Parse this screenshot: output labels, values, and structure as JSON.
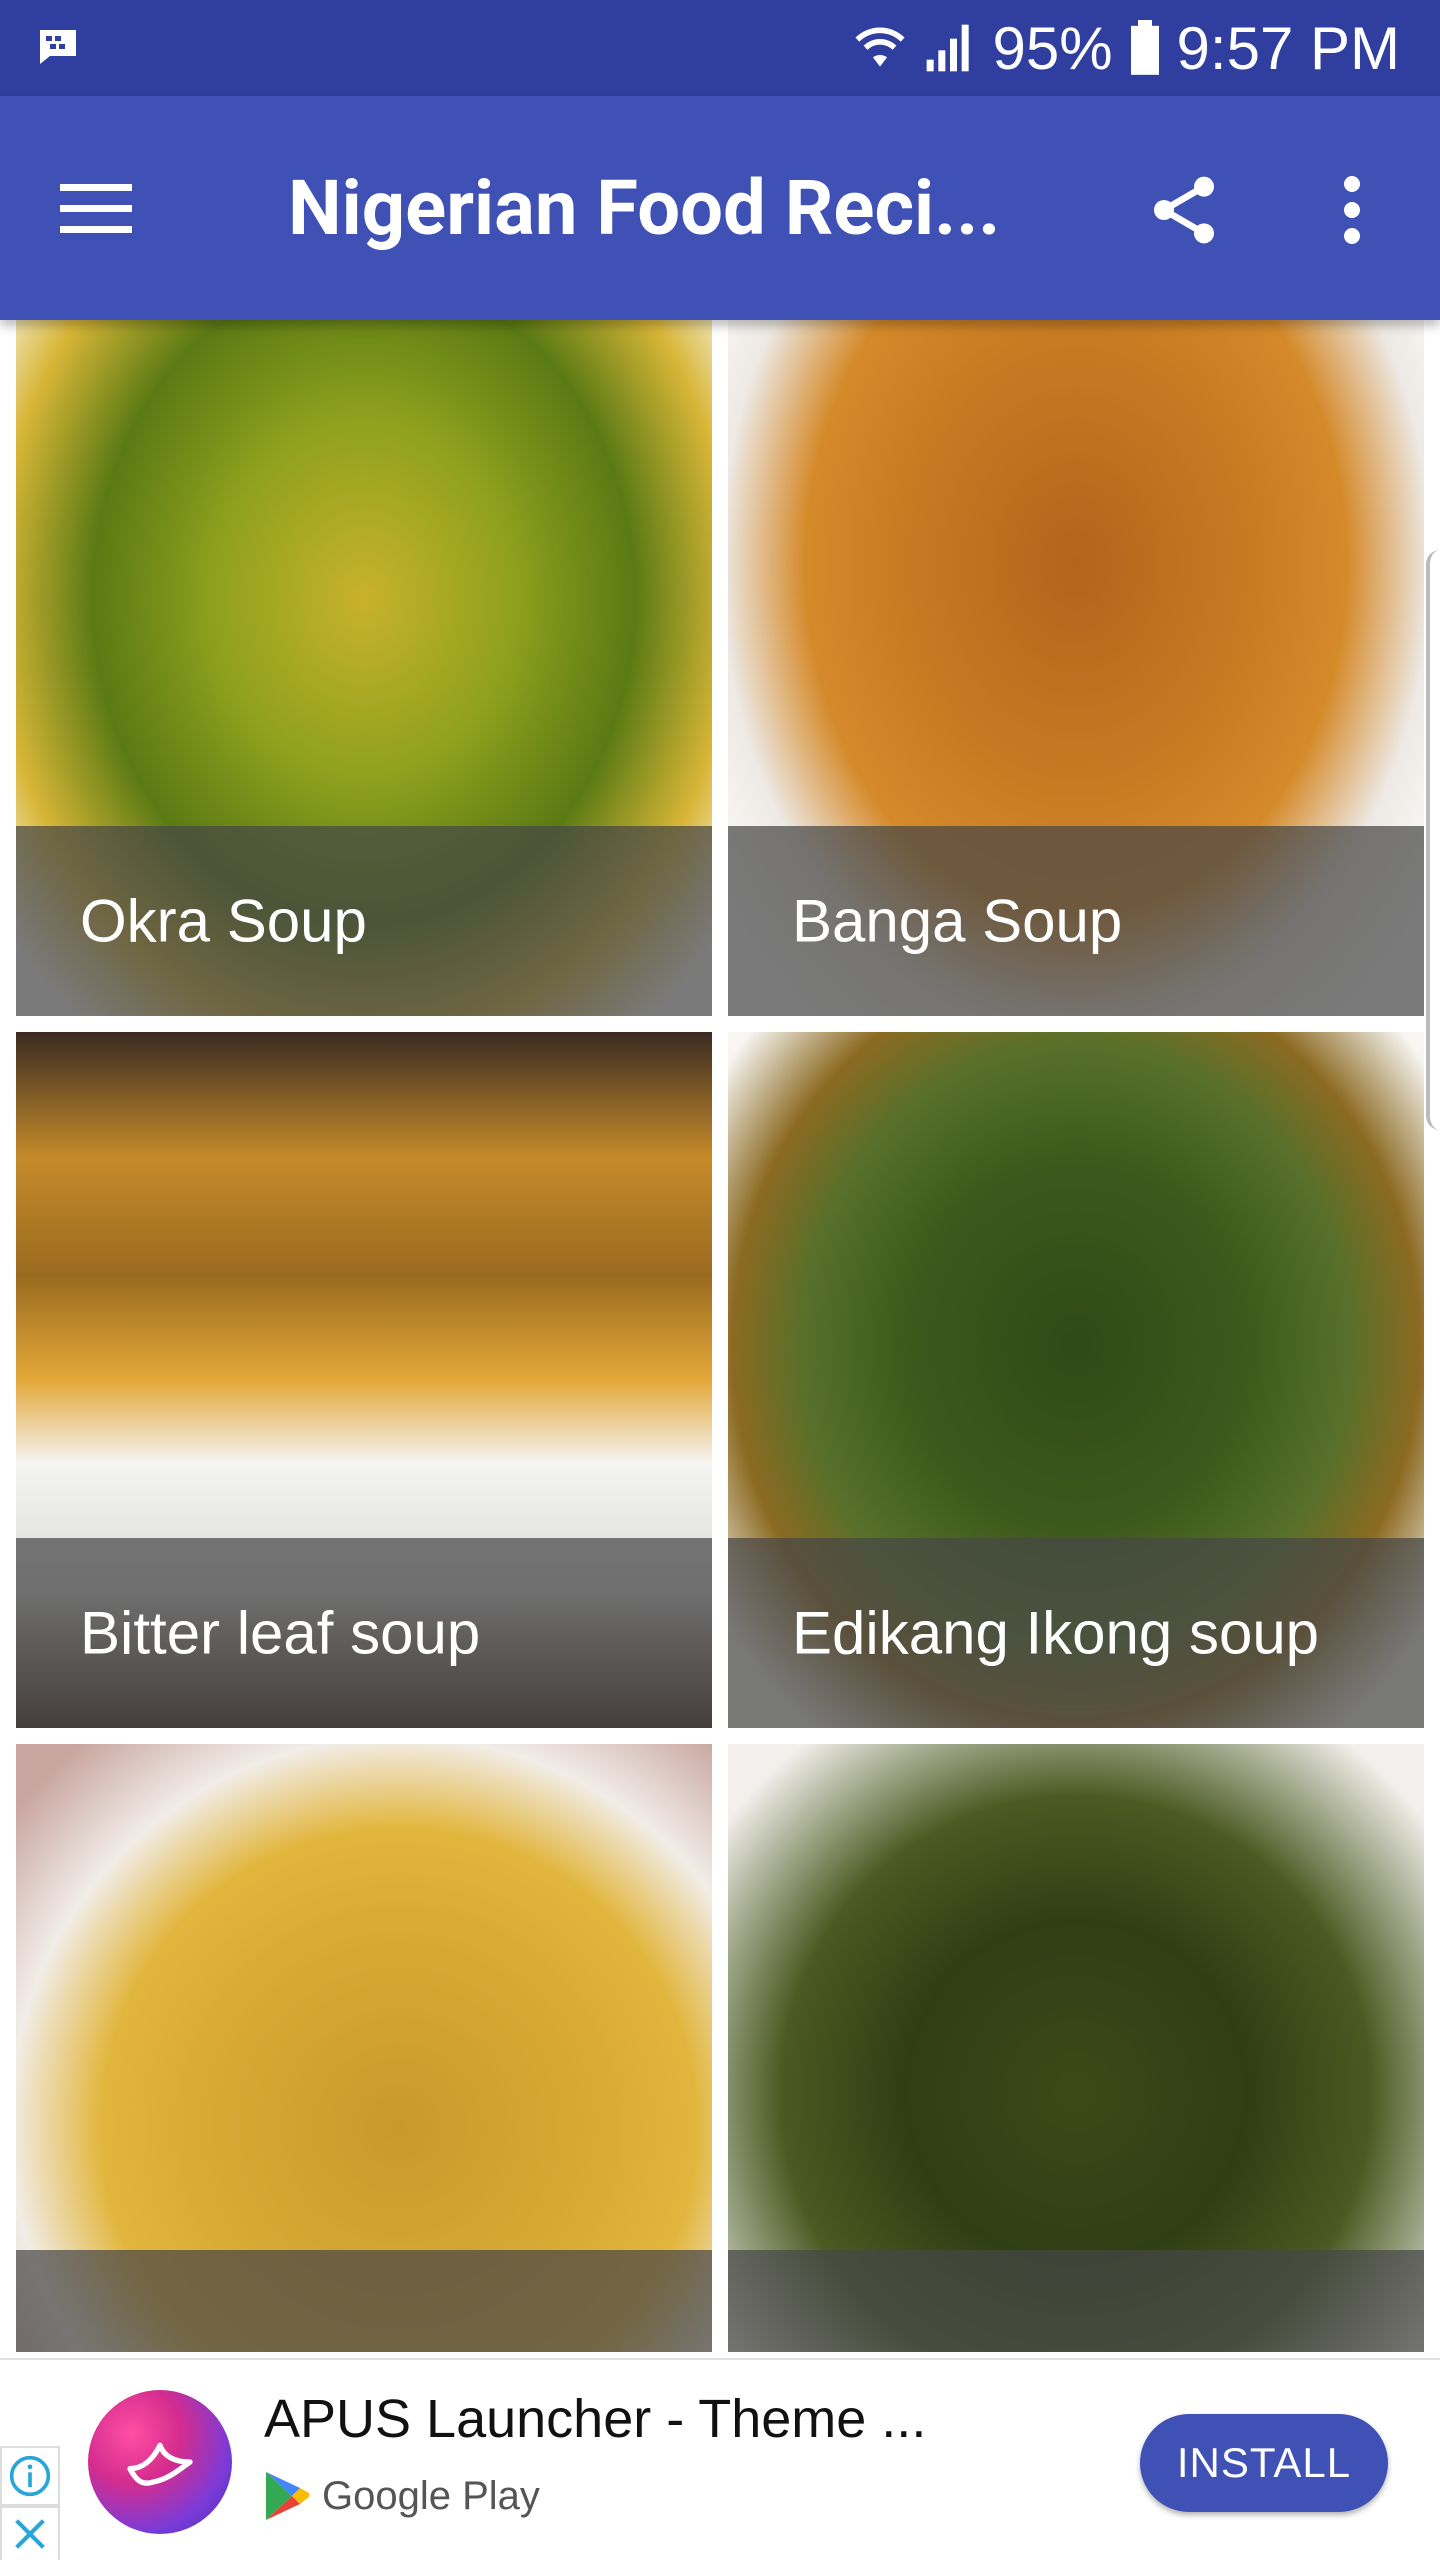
{
  "status_bar": {
    "battery": "95%",
    "time": "9:57 PM",
    "icons": [
      "messenger-notification-icon",
      "wifi-icon",
      "signal-icon",
      "battery-icon"
    ]
  },
  "app_bar": {
    "title": "Nigerian Food Reci...",
    "icons": [
      "menu-icon",
      "share-icon",
      "more-vert-icon"
    ]
  },
  "recipes": [
    {
      "label": "Okra Soup"
    },
    {
      "label": "Banga Soup"
    },
    {
      "label": "Bitter leaf soup"
    },
    {
      "label": "Edikang Ikong soup"
    },
    {
      "label": ""
    },
    {
      "label": ""
    }
  ],
  "ad": {
    "app_name": "APUS Launcher - Theme ...",
    "store": "Google Play",
    "install_label": "INSTALL"
  },
  "colors": {
    "status_bar": "#303F9F",
    "app_bar": "#3F51B5",
    "install_button": "#3F51B5"
  }
}
